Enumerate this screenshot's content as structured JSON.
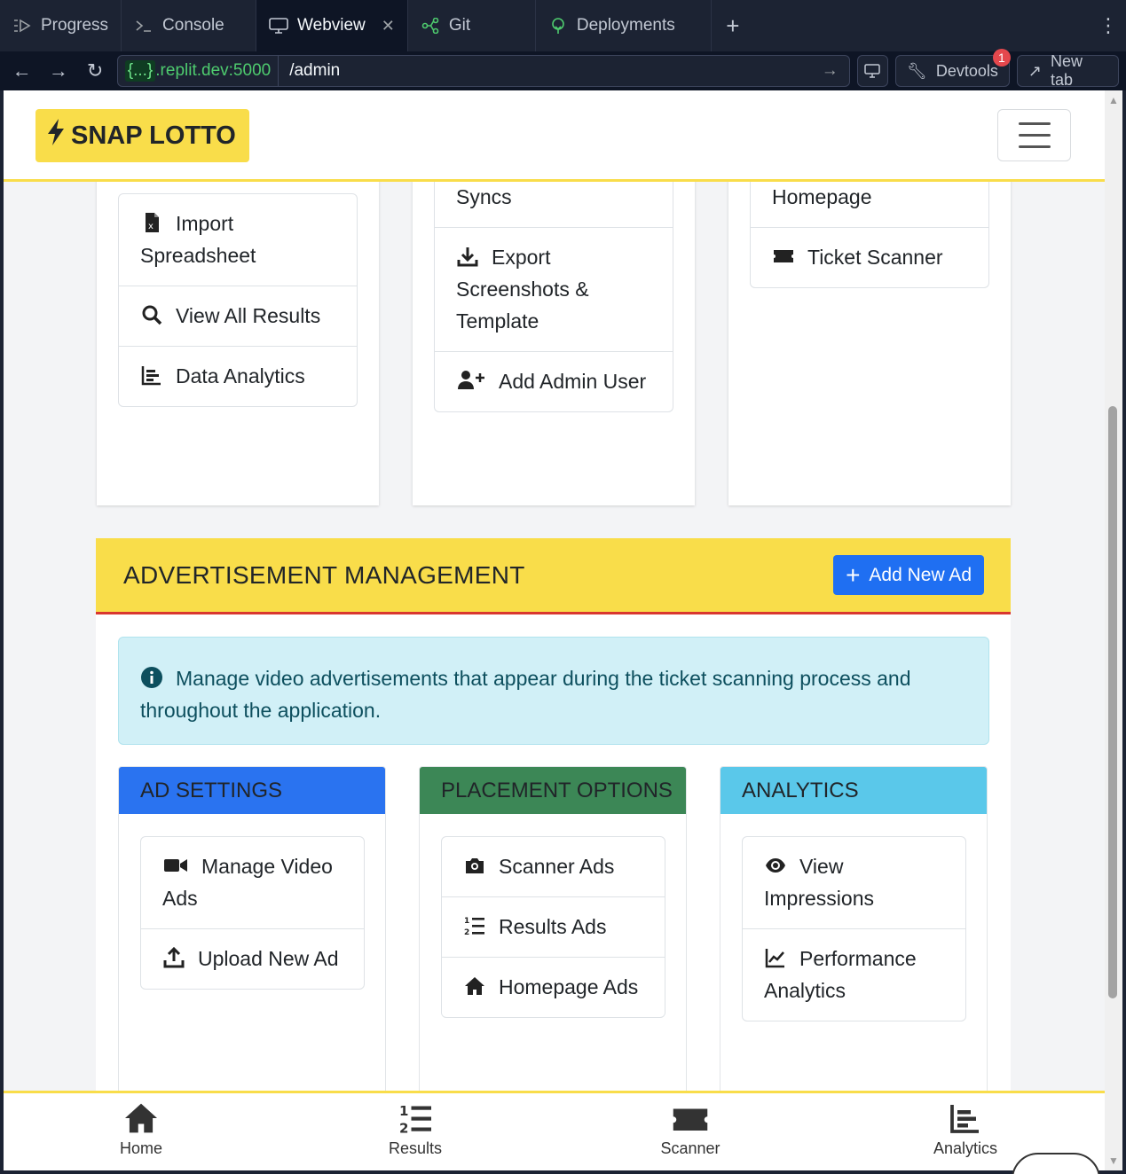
{
  "tabs": [
    {
      "label": "Progress",
      "icon": "progress-icon"
    },
    {
      "label": "Console",
      "icon": "terminal-icon"
    },
    {
      "label": "Webview",
      "icon": "monitor-icon",
      "active": true
    },
    {
      "label": "Git",
      "icon": "git-icon"
    },
    {
      "label": "Deployments",
      "icon": "deployments-icon"
    }
  ],
  "address": {
    "host_prefix": "{...}",
    "host": ".replit.dev:5000",
    "path": "/admin"
  },
  "toolbar": {
    "devtools_label": "Devtools",
    "devtools_badge": "1",
    "newtab_label": "New tab"
  },
  "app": {
    "brand": "SNAP LOTTO"
  },
  "top_cards": {
    "col1": [
      "Import Spreadsheet",
      "View All Results",
      "Data Analytics"
    ],
    "col2": [
      "Manage Data Syncs",
      "Export Screenshots & Template",
      "Add Admin User"
    ],
    "col3": [
      "Public Homepage",
      "Ticket Scanner"
    ]
  },
  "ad_management": {
    "title": "ADVERTISEMENT MANAGEMENT",
    "add_button": "Add New Ad",
    "info_text": "Manage video advertisements that appear during the ticket scanning process and throughout the application.",
    "sections": [
      {
        "title": "AD SETTINGS",
        "color": "#2a73f0",
        "items": [
          "Manage Video Ads",
          "Upload New Ad"
        ]
      },
      {
        "title": "PLACEMENT OPTIONS",
        "color": "#3c8756",
        "items": [
          "Scanner Ads",
          "Results Ads",
          "Homepage Ads"
        ]
      },
      {
        "title": "ANALYTICS",
        "color": "#5ac8ea",
        "items": [
          "View Impressions",
          "Performance Analytics"
        ]
      }
    ]
  },
  "bottom_nav": [
    "Home",
    "Results",
    "Scanner",
    "Analytics"
  ],
  "colors": {
    "brand_yellow": "#f9dd4a",
    "primary": "#1f6ff2",
    "accent_red": "#d9372f"
  }
}
